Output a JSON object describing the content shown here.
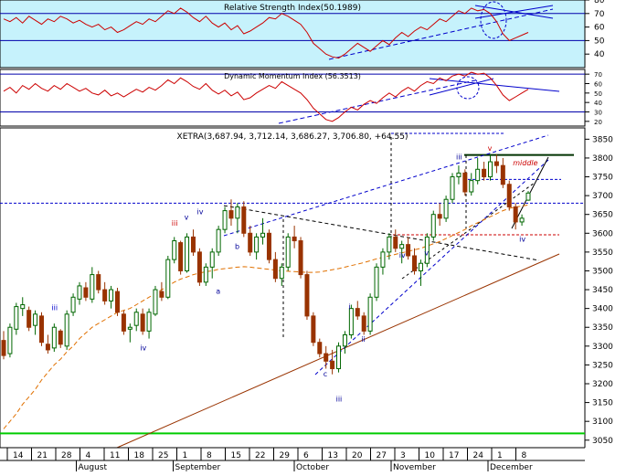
{
  "chart_data": [
    {
      "type": "line",
      "title": "Relative Strength Index(50.1989)",
      "ylim": [
        30,
        80
      ],
      "yticks": [
        "40",
        "50",
        "60",
        "70",
        "80"
      ],
      "reference_levels": [
        70,
        50
      ],
      "background": "#c6f2fc",
      "series": [
        {
          "color": "#cc0000",
          "values": [
            66,
            64,
            67,
            63,
            68,
            65,
            62,
            66,
            64,
            68,
            66,
            63,
            65,
            62,
            60,
            62,
            58,
            60,
            56,
            58,
            61,
            64,
            62,
            66,
            64,
            68,
            72,
            70,
            74,
            71,
            67,
            64,
            68,
            63,
            60,
            63,
            58,
            61,
            55,
            57,
            60,
            63,
            67,
            66,
            70,
            68,
            65,
            62,
            56,
            48,
            44,
            40,
            38,
            37,
            40,
            44,
            48,
            45,
            42,
            46,
            50,
            47,
            52,
            56,
            53,
            57,
            60,
            58,
            62,
            66,
            64,
            68,
            72,
            70,
            74,
            72,
            73,
            70,
            64,
            55,
            50,
            52,
            54,
            56
          ]
        }
      ],
      "annotations": [
        "dashed uptrend line",
        "converging trend lines",
        "dashed ellipse marks"
      ]
    },
    {
      "type": "line",
      "title": "Dynamic Momentum Index (56.3513)",
      "ylim": [
        15,
        75
      ],
      "yticks": [
        "20",
        "30",
        "40",
        "50",
        "60",
        "70"
      ],
      "reference_levels": [
        70,
        30
      ],
      "series": [
        {
          "color": "#cc0000",
          "values": [
            52,
            56,
            50,
            58,
            54,
            60,
            55,
            52,
            58,
            54,
            60,
            56,
            52,
            55,
            50,
            48,
            53,
            47,
            50,
            46,
            50,
            54,
            51,
            56,
            53,
            58,
            64,
            60,
            66,
            62,
            57,
            54,
            60,
            53,
            49,
            53,
            47,
            51,
            43,
            45,
            50,
            54,
            58,
            55,
            62,
            58,
            54,
            50,
            43,
            34,
            28,
            22,
            20,
            24,
            30,
            35,
            32,
            38,
            42,
            39,
            45,
            50,
            46,
            52,
            56,
            52,
            58,
            62,
            60,
            66,
            63,
            68,
            70,
            68,
            72,
            70,
            71,
            66,
            58,
            48,
            42,
            46,
            50,
            54
          ]
        }
      ],
      "annotations": [
        "dashed uptrend line",
        "converging trend lines",
        "dashed ellipse mark"
      ]
    },
    {
      "type": "candlestick",
      "title": "XETRA(3,687.94, 3,712.14, 3,686.27, 3,706.80, +64.55)",
      "ylim": [
        3030,
        3880
      ],
      "yticks": [
        "3050",
        "3100",
        "3150",
        "3200",
        "3250",
        "3300",
        "3350",
        "3400",
        "3450",
        "3500",
        "3550",
        "3600",
        "3650",
        "3700",
        "3750",
        "3800",
        "3850"
      ],
      "day_ticks": [
        "14",
        "21",
        "28",
        "4",
        "11",
        "18",
        "25",
        "1",
        "8",
        "15",
        "22",
        "29",
        "6",
        "13",
        "20",
        "27",
        "3",
        "10",
        "17",
        "24",
        "1",
        "8"
      ],
      "month_labels": [
        "August",
        "September",
        "October",
        "November",
        "December"
      ],
      "colors": {
        "up": "#006600",
        "down": "#993300",
        "ma": "#e07000",
        "support_line": "#993300",
        "trend": "#0000cc",
        "green_level": "#00cc00"
      },
      "candles": [
        {
          "o": 3315,
          "h": 3340,
          "l": 3265,
          "c": 3275
        },
        {
          "o": 3280,
          "h": 3360,
          "l": 3270,
          "c": 3350
        },
        {
          "o": 3345,
          "h": 3415,
          "l": 3330,
          "c": 3405
        },
        {
          "o": 3400,
          "h": 3430,
          "l": 3380,
          "c": 3410
        },
        {
          "o": 3395,
          "h": 3405,
          "l": 3340,
          "c": 3350
        },
        {
          "o": 3355,
          "h": 3395,
          "l": 3330,
          "c": 3385
        },
        {
          "o": 3380,
          "h": 3390,
          "l": 3300,
          "c": 3310
        },
        {
          "o": 3305,
          "h": 3330,
          "l": 3280,
          "c": 3290
        },
        {
          "o": 3295,
          "h": 3360,
          "l": 3285,
          "c": 3350
        },
        {
          "o": 3340,
          "h": 3345,
          "l": 3295,
          "c": 3305
        },
        {
          "o": 3300,
          "h": 3395,
          "l": 3290,
          "c": 3385
        },
        {
          "o": 3390,
          "h": 3440,
          "l": 3380,
          "c": 3430
        },
        {
          "o": 3425,
          "h": 3470,
          "l": 3410,
          "c": 3460
        },
        {
          "o": 3455,
          "h": 3470,
          "l": 3420,
          "c": 3430
        },
        {
          "o": 3425,
          "h": 3510,
          "l": 3415,
          "c": 3490
        },
        {
          "o": 3490,
          "h": 3500,
          "l": 3440,
          "c": 3450
        },
        {
          "o": 3450,
          "h": 3470,
          "l": 3410,
          "c": 3420
        },
        {
          "o": 3420,
          "h": 3460,
          "l": 3400,
          "c": 3450
        },
        {
          "o": 3445,
          "h": 3455,
          "l": 3380,
          "c": 3390
        },
        {
          "o": 3385,
          "h": 3395,
          "l": 3330,
          "c": 3340
        },
        {
          "o": 3345,
          "h": 3360,
          "l": 3310,
          "c": 3350
        },
        {
          "o": 3355,
          "h": 3400,
          "l": 3340,
          "c": 3390
        },
        {
          "o": 3385,
          "h": 3400,
          "l": 3330,
          "c": 3340
        },
        {
          "o": 3340,
          "h": 3400,
          "l": 3320,
          "c": 3390
        },
        {
          "o": 3385,
          "h": 3460,
          "l": 3380,
          "c": 3450
        },
        {
          "o": 3445,
          "h": 3470,
          "l": 3420,
          "c": 3430
        },
        {
          "o": 3430,
          "h": 3540,
          "l": 3425,
          "c": 3530
        },
        {
          "o": 3530,
          "h": 3590,
          "l": 3520,
          "c": 3580
        },
        {
          "o": 3575,
          "h": 3580,
          "l": 3490,
          "c": 3500
        },
        {
          "o": 3500,
          "h": 3600,
          "l": 3495,
          "c": 3590
        },
        {
          "o": 3590,
          "h": 3610,
          "l": 3540,
          "c": 3550
        },
        {
          "o": 3550,
          "h": 3560,
          "l": 3460,
          "c": 3470
        },
        {
          "o": 3470,
          "h": 3520,
          "l": 3460,
          "c": 3510
        },
        {
          "o": 3510,
          "h": 3560,
          "l": 3480,
          "c": 3550
        },
        {
          "o": 3550,
          "h": 3620,
          "l": 3540,
          "c": 3610
        },
        {
          "o": 3610,
          "h": 3670,
          "l": 3600,
          "c": 3660
        },
        {
          "o": 3660,
          "h": 3690,
          "l": 3620,
          "c": 3640
        },
        {
          "o": 3640,
          "h": 3680,
          "l": 3600,
          "c": 3670
        },
        {
          "o": 3670,
          "h": 3685,
          "l": 3590,
          "c": 3600
        },
        {
          "o": 3600,
          "h": 3620,
          "l": 3540,
          "c": 3550
        },
        {
          "o": 3550,
          "h": 3600,
          "l": 3530,
          "c": 3590
        },
        {
          "o": 3590,
          "h": 3640,
          "l": 3570,
          "c": 3600
        },
        {
          "o": 3600,
          "h": 3610,
          "l": 3520,
          "c": 3530
        },
        {
          "o": 3530,
          "h": 3550,
          "l": 3470,
          "c": 3480
        },
        {
          "o": 3480,
          "h": 3520,
          "l": 3460,
          "c": 3510
        },
        {
          "o": 3510,
          "h": 3600,
          "l": 3500,
          "c": 3590
        },
        {
          "o": 3590,
          "h": 3620,
          "l": 3560,
          "c": 3580
        },
        {
          "o": 3580,
          "h": 3590,
          "l": 3480,
          "c": 3490
        },
        {
          "o": 3490,
          "h": 3500,
          "l": 3370,
          "c": 3380
        },
        {
          "o": 3380,
          "h": 3390,
          "l": 3300,
          "c": 3310
        },
        {
          "o": 3310,
          "h": 3320,
          "l": 3270,
          "c": 3280
        },
        {
          "o": 3280,
          "h": 3300,
          "l": 3240,
          "c": 3260
        },
        {
          "o": 3260,
          "h": 3290,
          "l": 3225,
          "c": 3240
        },
        {
          "o": 3240,
          "h": 3310,
          "l": 3230,
          "c": 3300
        },
        {
          "o": 3300,
          "h": 3340,
          "l": 3280,
          "c": 3330
        },
        {
          "o": 3330,
          "h": 3410,
          "l": 3320,
          "c": 3400
        },
        {
          "o": 3400,
          "h": 3420,
          "l": 3370,
          "c": 3380
        },
        {
          "o": 3380,
          "h": 3390,
          "l": 3330,
          "c": 3340
        },
        {
          "o": 3340,
          "h": 3440,
          "l": 3330,
          "c": 3430
        },
        {
          "o": 3430,
          "h": 3520,
          "l": 3420,
          "c": 3510
        },
        {
          "o": 3510,
          "h": 3560,
          "l": 3490,
          "c": 3550
        },
        {
          "o": 3550,
          "h": 3600,
          "l": 3530,
          "c": 3590
        },
        {
          "o": 3590,
          "h": 3610,
          "l": 3550,
          "c": 3560
        },
        {
          "o": 3560,
          "h": 3580,
          "l": 3520,
          "c": 3570
        },
        {
          "o": 3570,
          "h": 3590,
          "l": 3530,
          "c": 3540
        },
        {
          "o": 3540,
          "h": 3560,
          "l": 3490,
          "c": 3500
        },
        {
          "o": 3500,
          "h": 3530,
          "l": 3460,
          "c": 3520
        },
        {
          "o": 3520,
          "h": 3600,
          "l": 3510,
          "c": 3590
        },
        {
          "o": 3590,
          "h": 3660,
          "l": 3580,
          "c": 3650
        },
        {
          "o": 3650,
          "h": 3680,
          "l": 3620,
          "c": 3640
        },
        {
          "o": 3640,
          "h": 3700,
          "l": 3630,
          "c": 3690
        },
        {
          "o": 3690,
          "h": 3760,
          "l": 3680,
          "c": 3750
        },
        {
          "o": 3750,
          "h": 3780,
          "l": 3730,
          "c": 3760
        },
        {
          "o": 3760,
          "h": 3770,
          "l": 3700,
          "c": 3710
        },
        {
          "o": 3710,
          "h": 3760,
          "l": 3700,
          "c": 3740
        },
        {
          "o": 3740,
          "h": 3800,
          "l": 3730,
          "c": 3770
        },
        {
          "o": 3770,
          "h": 3790,
          "l": 3740,
          "c": 3750
        },
        {
          "o": 3750,
          "h": 3810,
          "l": 3740,
          "c": 3790
        },
        {
          "o": 3790,
          "h": 3810,
          "l": 3760,
          "c": 3780
        },
        {
          "o": 3780,
          "h": 3800,
          "l": 3720,
          "c": 3730
        },
        {
          "o": 3730,
          "h": 3740,
          "l": 3660,
          "c": 3670
        },
        {
          "o": 3670,
          "h": 3680,
          "l": 3610,
          "c": 3630
        },
        {
          "o": 3630,
          "h": 3650,
          "l": 3620,
          "c": 3640
        },
        {
          "o": 3687.94,
          "h": 3712.14,
          "l": 3686.27,
          "c": 3706.8
        }
      ],
      "moving_average": [
        3080,
        3100,
        3120,
        3145,
        3165,
        3185,
        3210,
        3230,
        3250,
        3265,
        3285,
        3300,
        3320,
        3335,
        3350,
        3360,
        3370,
        3380,
        3390,
        3395,
        3400,
        3410,
        3420,
        3430,
        3440,
        3450,
        3460,
        3470,
        3478,
        3484,
        3490,
        3494,
        3498,
        3500,
        3504,
        3506,
        3508,
        3510,
        3511,
        3510,
        3508,
        3506,
        3504,
        3502,
        3500,
        3499,
        3498,
        3497,
        3496,
        3496,
        3497,
        3500,
        3503,
        3506,
        3510,
        3514,
        3518,
        3522,
        3527,
        3532,
        3536,
        3540,
        3544,
        3548,
        3552,
        3556,
        3560,
        3566,
        3572,
        3578,
        3586,
        3594,
        3602,
        3610,
        3620,
        3628,
        3636,
        3644,
        3652,
        3660,
        3666,
        3670,
        3672,
        3675
      ],
      "wave_labels": [
        "iii",
        "v",
        "a",
        "b",
        "c",
        "iv",
        "i",
        "ii",
        "iii",
        "v",
        "middle",
        "iv",
        "iii",
        "iv",
        "iii",
        "v",
        "iv"
      ],
      "key_levels": [
        3808,
        3743,
        3596,
        3680,
        3068
      ]
    }
  ]
}
